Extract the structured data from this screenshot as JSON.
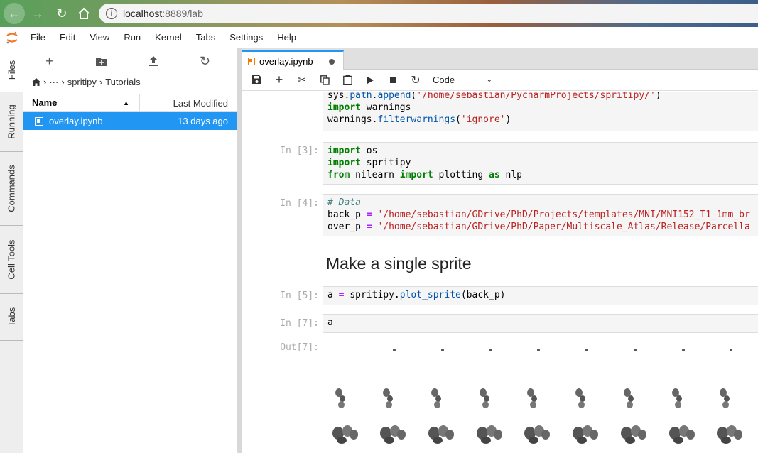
{
  "browser": {
    "url_host": "localhost",
    "url_path": ":8889/lab"
  },
  "menu": {
    "items": [
      "File",
      "Edit",
      "View",
      "Run",
      "Kernel",
      "Tabs",
      "Settings",
      "Help"
    ]
  },
  "side_tabs": [
    "Files",
    "Running",
    "Commands",
    "Cell Tools",
    "Tabs"
  ],
  "file_browser": {
    "breadcrumb": {
      "ellipsis": "···",
      "folder1": "spritipy",
      "folder2": "Tutorials"
    },
    "columns": {
      "name": "Name",
      "modified": "Last Modified"
    },
    "files": [
      {
        "name": "overlay.ipynb",
        "modified": "13 days ago"
      }
    ]
  },
  "notebook": {
    "tab_title": "overlay.ipynb",
    "cell_type": "Code",
    "cells": {
      "c0": {
        "line1": [
          "sys",
          ".path.",
          "append",
          "('/home/sebastian/PycharmProjects/spritipy/')"
        ],
        "line2_kw": "import",
        "line2_rest": " warnings",
        "line3_pre": "warnings.",
        "line3_fn": "filterwarnings",
        "line3_str": "'ignore'"
      },
      "c3": {
        "prompt": "In [3]:"
      },
      "c4": {
        "prompt": "In [4]:",
        "comment": "# Data",
        "line2_var": "back_p",
        "line2_str": "'/home/sebastian/GDrive/PhD/Projects/templates/MNI/MNI152_T1_1mm_br",
        "line3_var": "over_p",
        "line3_str": "'/home/sebastian/GDrive/PhD/Paper/Multiscale_Atlas/Release/Parcella"
      },
      "heading": "Make a single sprite",
      "c5": {
        "prompt": "In [5]:",
        "var": "a",
        "mod": "spritipy.",
        "fn": "plot_sprite",
        "arg": "(back_p)"
      },
      "c7": {
        "prompt": "In [7]:",
        "code": "a"
      },
      "out7": {
        "prompt": "Out[7]:"
      }
    }
  }
}
